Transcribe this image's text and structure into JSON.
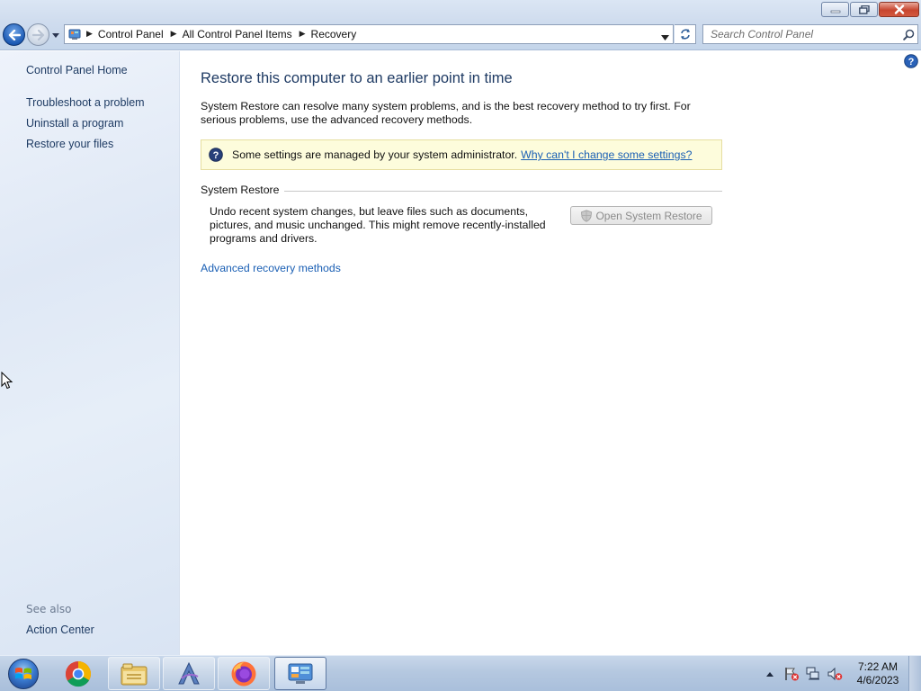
{
  "window": {
    "minimize_label": "",
    "maximize_label": "",
    "close_label": ""
  },
  "address_bar": {
    "breadcrumbs": [
      "Control Panel",
      "All Control Panel Items",
      "Recovery"
    ]
  },
  "search": {
    "placeholder": "Search Control Panel"
  },
  "sidebar": {
    "home": "Control Panel Home",
    "links": [
      "Troubleshoot a problem",
      "Uninstall a program",
      "Restore your files"
    ],
    "see_also_label": "See also",
    "see_also_links": [
      "Action Center"
    ]
  },
  "main": {
    "title": "Restore this computer to an earlier point in time",
    "intro": "System Restore can resolve many system problems, and is the best recovery method to try first. For serious problems, use the advanced recovery methods.",
    "info_text": "Some settings are managed by your system administrator.",
    "info_link": "Why can't I change some settings?",
    "section_title": "System Restore",
    "section_desc": "Undo recent system changes, but leave files such as documents, pictures, and music unchanged. This might remove recently-installed programs and drivers.",
    "button_label": "Open System Restore",
    "advanced_link": "Advanced recovery methods"
  },
  "taskbar": {
    "apps": [
      "chrome-icon",
      "file-explorer-icon",
      "app-a-icon",
      "firefox-icon",
      "control-panel-icon"
    ],
    "clock_time": "7:22 AM",
    "clock_date": "4/6/2023"
  },
  "colors": {
    "link": "#1a5fb4",
    "title": "#1e3a63",
    "info_bg": "#fdfcdc",
    "sidebar_bg": "#e3ebf6"
  }
}
